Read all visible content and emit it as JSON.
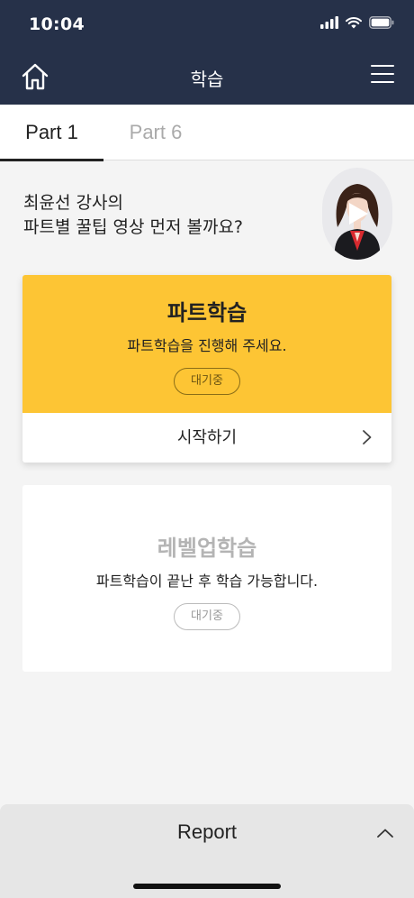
{
  "status": {
    "time": "10:04"
  },
  "nav": {
    "title": "학습"
  },
  "tabs": [
    {
      "label": "Part 1",
      "active": true
    },
    {
      "label": "Part 6",
      "active": false
    }
  ],
  "intro": {
    "line1": "최윤선 강사의",
    "line2": "파트별 꿀팁 영상 먼저 볼까요?"
  },
  "cards": {
    "part": {
      "title": "파트학습",
      "desc": "파트학습을 진행해 주세요.",
      "badge": "대기중",
      "action": "시작하기"
    },
    "levelup": {
      "title": "레벨업학습",
      "desc": "파트학습이 끝난 후 학습 가능합니다.",
      "badge": "대기중"
    }
  },
  "footer": {
    "report": "Report"
  },
  "colors": {
    "header": "#263149",
    "accent": "#fdc534"
  },
  "icons": [
    "home-icon",
    "menu-icon",
    "signal-icon",
    "wifi-icon",
    "battery-icon",
    "play-icon",
    "chevron-right-icon",
    "chevron-up-icon"
  ]
}
